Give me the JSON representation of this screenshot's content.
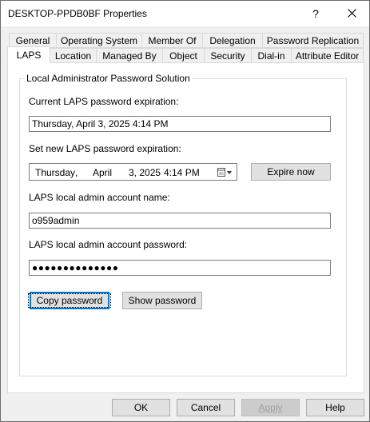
{
  "window": {
    "title": "DESKTOP-PPDB0BF Properties",
    "help_glyph": "?"
  },
  "tabs_row1": [
    {
      "label": "General"
    },
    {
      "label": "Operating System"
    },
    {
      "label": "Member Of"
    },
    {
      "label": "Delegation"
    },
    {
      "label": "Password Replication"
    }
  ],
  "tabs_row2": [
    {
      "label": "LAPS",
      "active": true
    },
    {
      "label": "Location"
    },
    {
      "label": "Managed By"
    },
    {
      "label": "Object"
    },
    {
      "label": "Security"
    },
    {
      "label": "Dial-in"
    },
    {
      "label": "Attribute Editor"
    }
  ],
  "laps": {
    "group_title": "Local Administrator Password Solution",
    "current_expiration_label": "Current LAPS password expiration:",
    "current_expiration_value": "Thursday, April 3, 2025 4:14 PM",
    "new_expiration_label": "Set new LAPS password expiration:",
    "date_weekday": "Thursday",
    "date_sep": ",",
    "date_month": "April",
    "date_day_year": "3, 2025",
    "date_time": "4:14 PM",
    "expire_now_label": "Expire now",
    "account_name_label": "LAPS local admin account name:",
    "account_name_value": "o959admin",
    "account_password_label": "LAPS local admin account password:",
    "account_password_value": "●●●●●●●●●●●●●●",
    "copy_password_label": "Copy password",
    "show_password_label": "Show password"
  },
  "footer": {
    "ok_label": "OK",
    "cancel_label": "Cancel",
    "apply_label": "Apply",
    "help_label": "Help"
  }
}
